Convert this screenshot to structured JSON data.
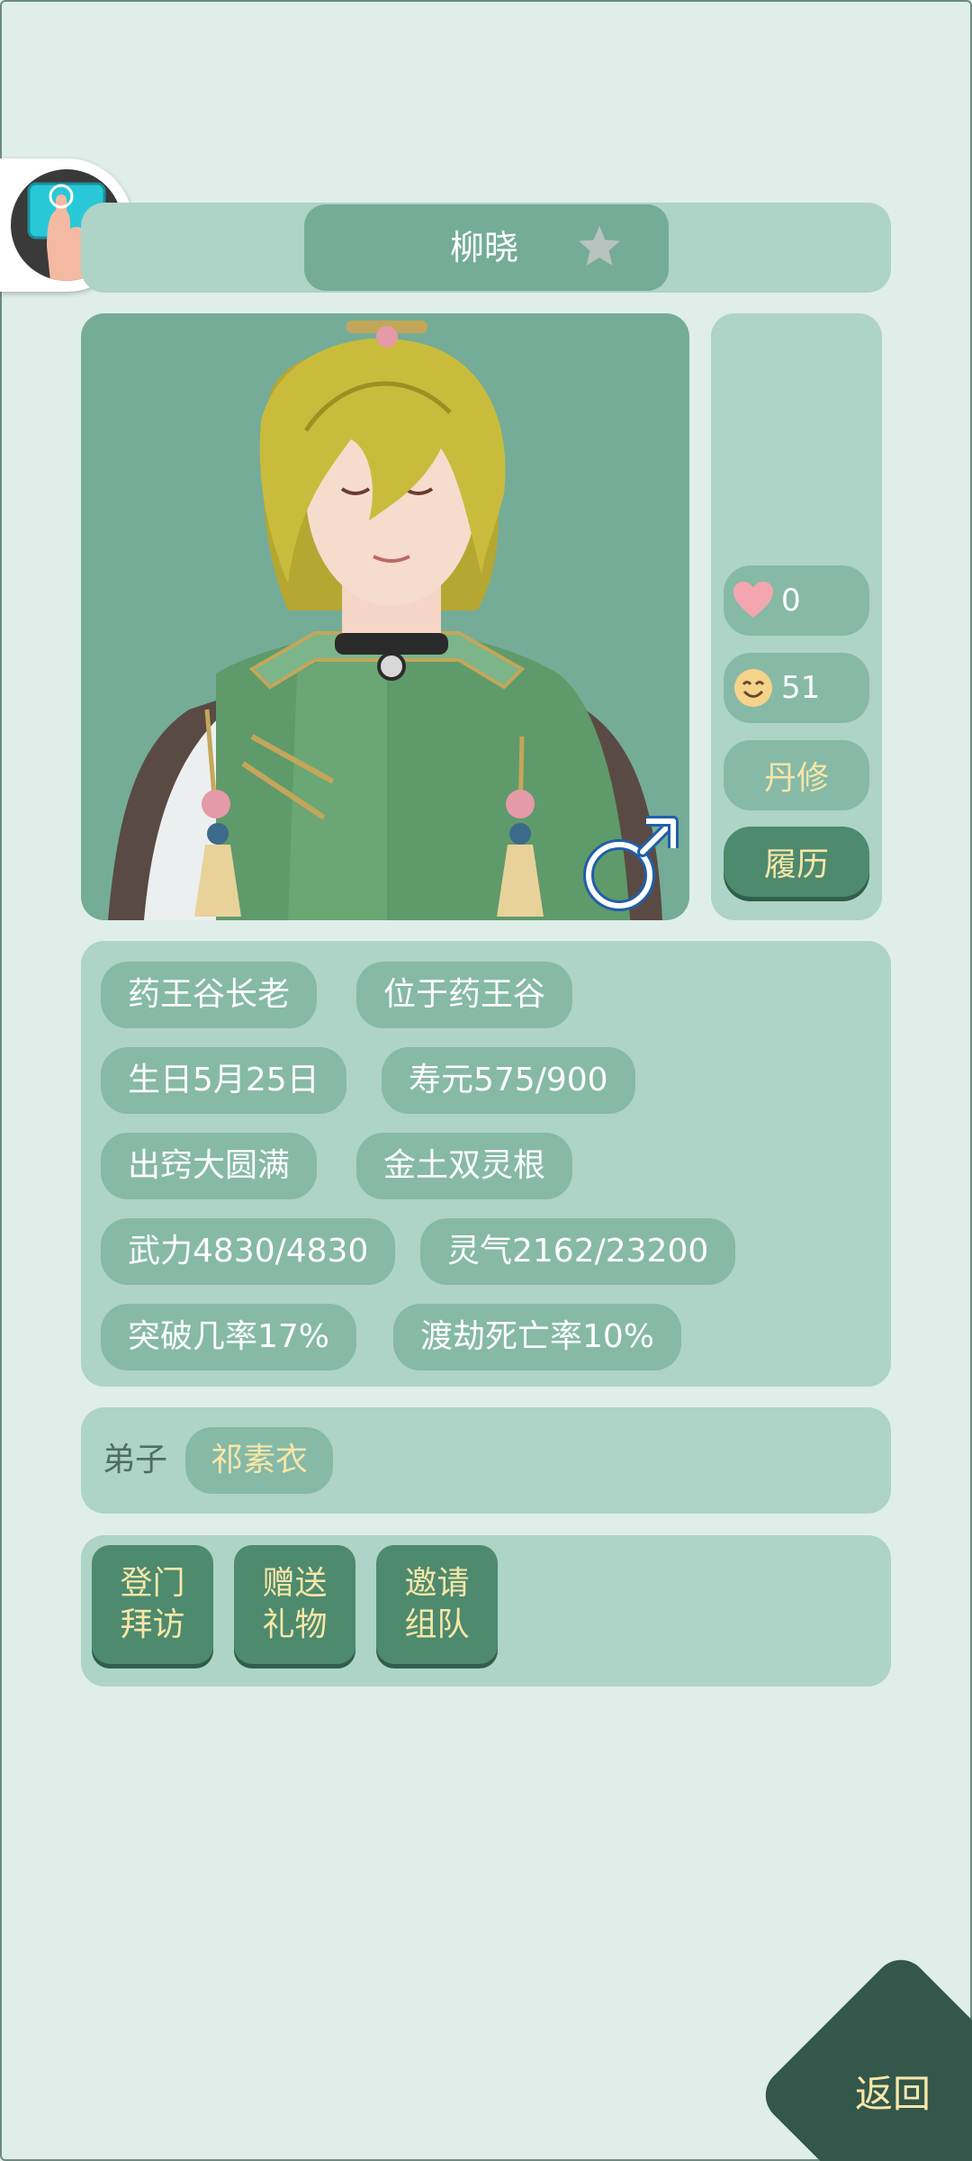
{
  "character": {
    "name": "柳晓",
    "favorited": false,
    "gender": "male"
  },
  "stats": {
    "affection": "0",
    "mood": "51",
    "profession": "丹修",
    "history_label": "履历"
  },
  "attributes": {
    "title": "药王谷长老",
    "location": "位于药王谷",
    "birthday": "生日5月25日",
    "lifespan": "寿元575/900",
    "realm": "出窍大圆满",
    "spirit_root": "金土双灵根",
    "force": "武力4830/4830",
    "spiritual_energy": "灵气2162/23200",
    "breakthrough_rate": "突破几率17%",
    "tribulation_death_rate": "渡劫死亡率10%"
  },
  "disciples": {
    "label": "弟子",
    "names": [
      "祁素衣"
    ]
  },
  "actions": {
    "visit": [
      "登门",
      "拜访"
    ],
    "gift": [
      "赠送",
      "礼物"
    ],
    "invite": [
      "邀请",
      "组队"
    ]
  },
  "navigation": {
    "back_label": "返回"
  },
  "colors": {
    "background": "#dfeee8",
    "panel": "#aed3c7",
    "pill": "#86b9a6",
    "button_dark": "#4d8a6e",
    "accent_text": "#f6e6a8"
  }
}
